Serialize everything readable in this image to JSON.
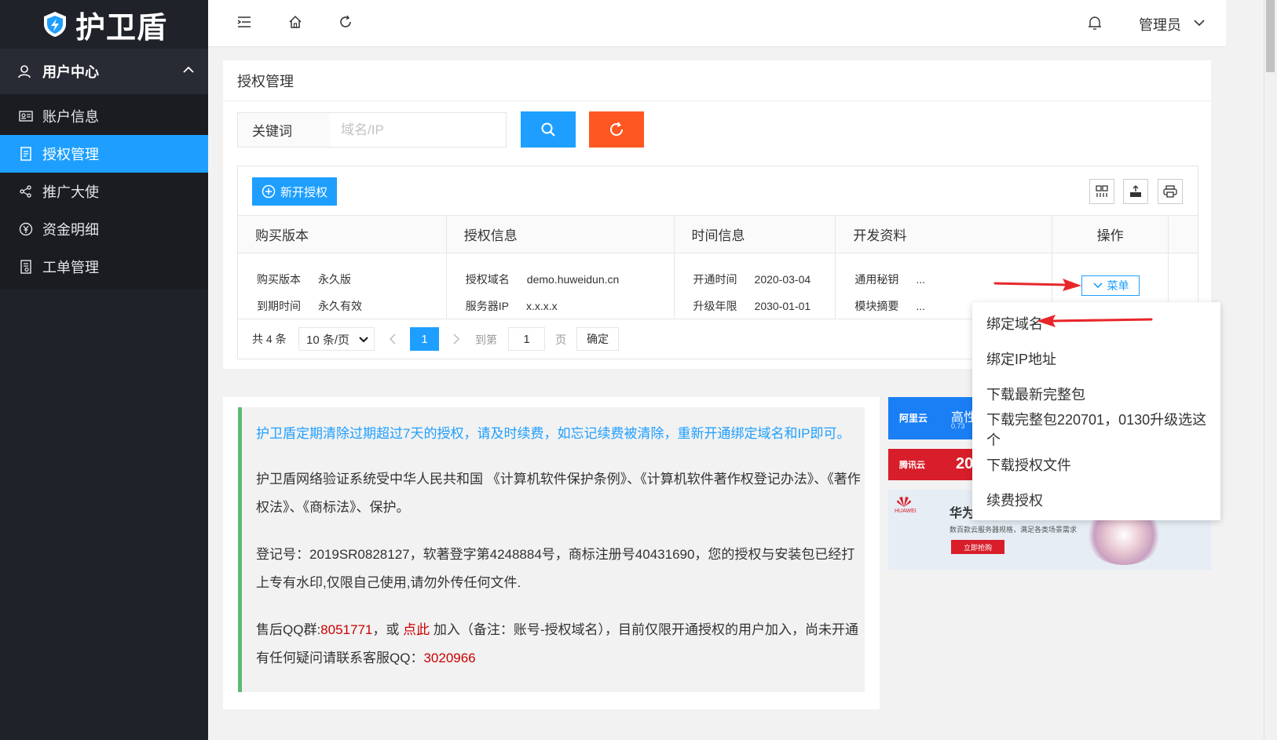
{
  "brand": {
    "name": "护卫盾"
  },
  "sidebar": {
    "group": "用户中心",
    "items": [
      {
        "label": "账户信息",
        "icon": "id-card-icon"
      },
      {
        "label": "授权管理",
        "icon": "document-icon"
      },
      {
        "label": "推广大使",
        "icon": "share-icon"
      },
      {
        "label": "资金明细",
        "icon": "yen-icon"
      },
      {
        "label": "工单管理",
        "icon": "ticket-icon"
      }
    ]
  },
  "topbar": {
    "user": "管理员"
  },
  "page": {
    "title": "授权管理"
  },
  "search": {
    "label": "关键词",
    "placeholder": "域名/IP"
  },
  "toolbar": {
    "new_label": "新开授权"
  },
  "table": {
    "headers": [
      "购买版本",
      "授权信息",
      "时间信息",
      "开发资料",
      "操作"
    ],
    "row": {
      "c1": [
        {
          "k": "购买版本",
          "v": "永久版"
        },
        {
          "k": "到期时间",
          "v": "永久有效"
        }
      ],
      "c2": [
        {
          "k": "授权域名",
          "v": "demo.huweidun.cn"
        },
        {
          "k": "服务器IP",
          "v": "x.x.x.x"
        }
      ],
      "c3": [
        {
          "k": "开通时间",
          "v": "2020-03-04"
        },
        {
          "k": "升级年限",
          "v": "2030-01-01"
        }
      ],
      "c4": [
        {
          "k": "通用秘钥",
          "v": "..."
        },
        {
          "k": "模块摘要",
          "v": "..."
        }
      ],
      "menu_label": "菜单"
    }
  },
  "pager": {
    "total": "共 4 条",
    "size": "10 条/页",
    "current": "1",
    "goto": "到第",
    "goto_value": "1",
    "page_word": "页",
    "confirm": "确定"
  },
  "dropdown": [
    "绑定域名",
    "绑定IP地址",
    "下载最新完整包",
    "下载完整包220701，0130升级选这个",
    "下载授权文件",
    "续费授权"
  ],
  "notice": {
    "headline": "护卫盾定期清除过期超过7天的授权，请及时续费，如忘记续费被清除，重新开通绑定域名和IP即可。",
    "p1": "护卫盾网络验证系统受中华人民共和国 《计算机软件保护条例》、《计算机软件著作权登记办法》、《著作权法》、《商标法》、保护。",
    "p2": "登记号：2019SR0828127，软著登字第4248884号，商标注册号40431690，您的授权与安装包已经打上专有水印,仅限自己使用,请勿外传任何文件.",
    "p3_a": "售后QQ群:",
    "qq_group": "8051771",
    "p3_b": "，或 ",
    "click_here": "点此",
    "p3_c": " 加入（备注：账号-授权域名），目前仅限开通授权的用户加入，尚未开通有任何疑问请联系客服QQ：",
    "qq": "3020966"
  },
  "ads": {
    "aliyun": {
      "brand": "阿里云",
      "text": "高性",
      "sub": "0.73"
    },
    "tencent": {
      "brand": "腾讯云",
      "text": "20"
    },
    "huawei": {
      "brand": "HUAWEI",
      "title": "华为",
      "desc": "数百款云服务器规格，满足各类场景需求",
      "cta": "立即抢购"
    }
  },
  "colors": {
    "accent": "#1e9fff",
    "reset": "#ff5722",
    "sidebar": "#20222a",
    "notice_bar": "#5fb878",
    "annotation": "#e8262a"
  }
}
